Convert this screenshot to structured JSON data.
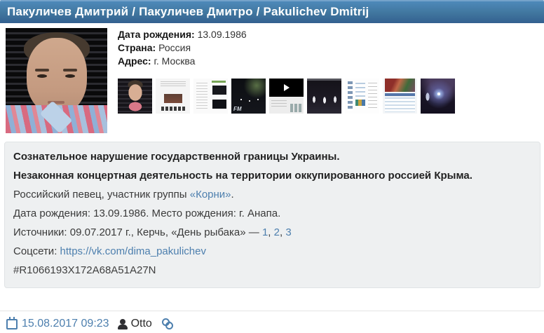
{
  "header": {
    "title": "Пакуличев Дмитрий / Пакуличев Дмитро / Pakulichev Dmitrij"
  },
  "profile": {
    "details": [
      {
        "label": "Дата рождения:",
        "value": " 13.09.1986"
      },
      {
        "label": "Страна:",
        "value": " Россия"
      },
      {
        "label": "Адрес:",
        "value": " г. Москва"
      }
    ],
    "thumbnails": [
      "portrait-photo-thumb",
      "article-webpage-thumb",
      "video-article-webpage-thumb",
      "concert-stage-thumb",
      "video-player-page-thumb",
      "stage-performers-thumb",
      "social-feed-page-thumb",
      "profile-info-card-thumb",
      "concert-spotlight-thumb"
    ],
    "thumb4_watermark": "FM"
  },
  "info": {
    "charge1": "Сознательное нарушение государственной границы Украины.",
    "charge2": "Незаконная концертная деятельность на территории оккупированного россией Крыма.",
    "bio": {
      "prefix": "Российский певец, участник группы ",
      "link": "«Корни»",
      "suffix": "."
    },
    "birth": "Дата рождения: 13.09.1986. Место рождения: г. Анапа.",
    "sources": {
      "prefix": "Источники: 09.07.2017 г., Керчь, «День рыбака» — ",
      "links": [
        "1",
        "2",
        "3"
      ],
      "separator": ", "
    },
    "social": {
      "label": "Соцсети: ",
      "link": "https://vk.com/dima_pakulichev"
    },
    "record_id": "#R1066193X172A68A51A27N"
  },
  "footer": {
    "datetime": "15.08.2017 09:23",
    "author": "Otto"
  },
  "colors": {
    "header_gradient_top": "#4f8bbd",
    "header_gradient_bottom": "#336090",
    "link": "#4d7fae",
    "infobox_background": "#eef0f1",
    "infobox_border": "#e0e3e5"
  }
}
